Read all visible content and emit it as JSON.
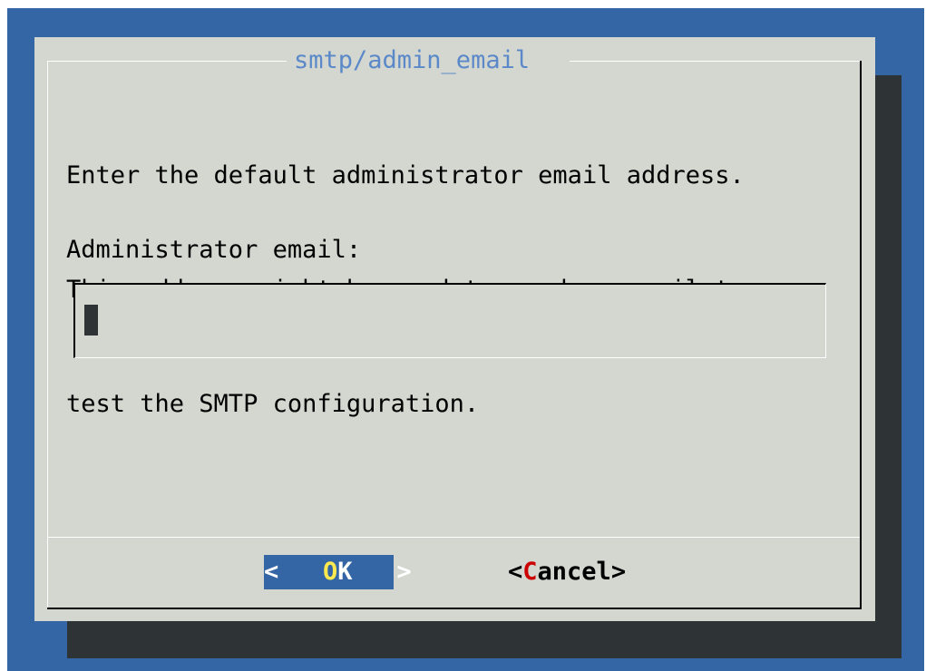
{
  "dialog": {
    "title": "smtp/admin_email",
    "prompt_lines": [
      "Enter the default administrator email address.",
      "This address might be used to send an email to",
      "test the SMTP configuration."
    ],
    "field_label": "Administrator email:",
    "field_value": ""
  },
  "buttons": {
    "ok": {
      "open": "< ",
      "hotkey": "O",
      "rest": "K",
      "close": " >"
    },
    "cancel": {
      "open": "<",
      "hotkey": "C",
      "rest": "ancel",
      "close": ">"
    }
  },
  "colors": {
    "desktop_bg": "#3465a4",
    "dialog_bg": "#d3d7cf",
    "shadow": "#2e3436",
    "title": "#5b88c9",
    "selected_button_bg": "#3465a4",
    "hotkey_selected": "#fce94f",
    "hotkey_unselected": "#cc0000"
  },
  "icons": {
    "cursor": "text-cursor-block"
  }
}
